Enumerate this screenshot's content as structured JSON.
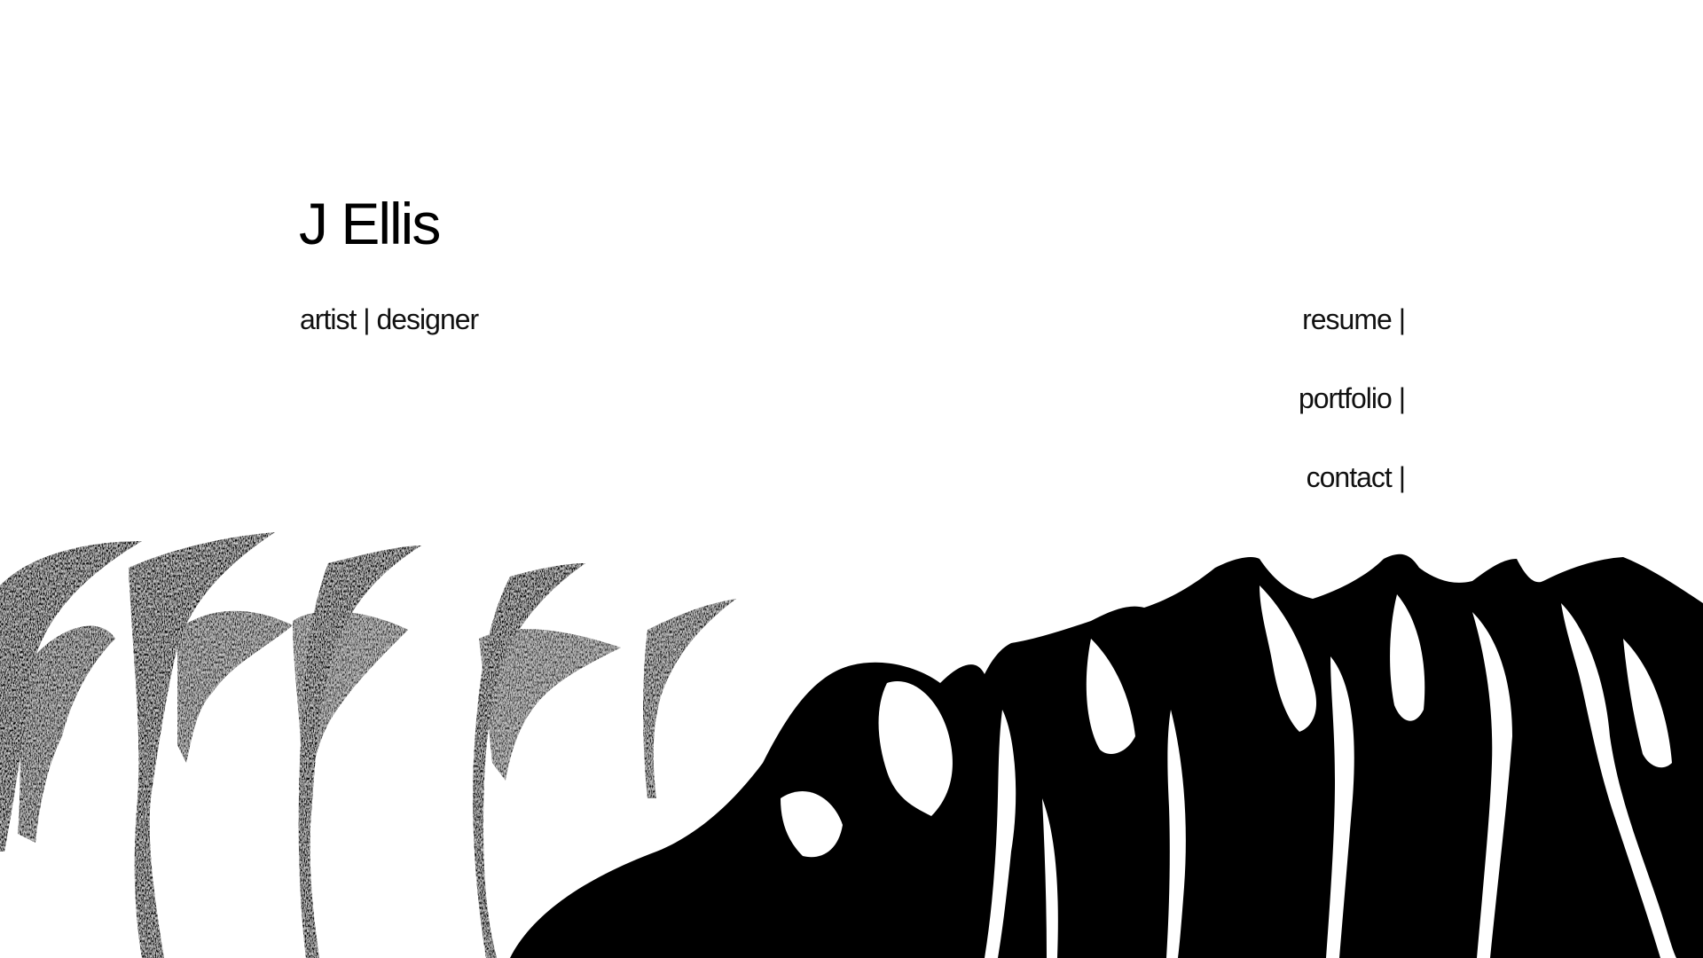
{
  "site": {
    "title": "J Ellis",
    "tagline": "artist | designer"
  },
  "nav": {
    "items": [
      {
        "label": "resume |",
        "name": "nav-resume-link"
      },
      {
        "label": "portfolio |",
        "name": "nav-portfolio-link"
      },
      {
        "label": "contact |",
        "name": "nav-contact-link"
      }
    ]
  },
  "colors": {
    "background": "#ffffff",
    "text": "#111111",
    "paint": "#000000"
  }
}
